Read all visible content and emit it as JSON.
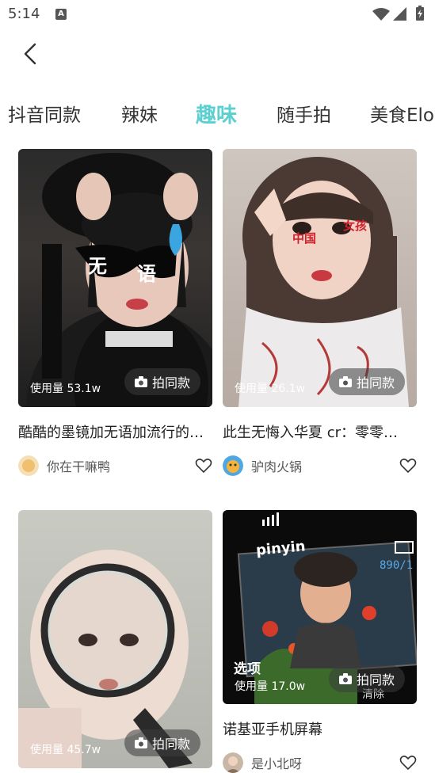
{
  "status_bar": {
    "time": "5:14",
    "indicator": "A"
  },
  "tabs": [
    {
      "label": "抖音同款"
    },
    {
      "label": "辣妹"
    },
    {
      "label": "趣味"
    },
    {
      "label": "随手拍"
    },
    {
      "label": "美食Elo"
    }
  ],
  "cards": [
    {
      "usage": "使用量 53.1w",
      "button": "拍同款",
      "title": "酷酷的墨镜加无语加流行的…",
      "author": "你在干嘛鸭",
      "overlay": [
        "无",
        "语"
      ]
    },
    {
      "usage": "使用量 26.1w",
      "button": "拍同款",
      "title": "此生无悔入华夏  cr：零零…",
      "author": "驴肉火锅",
      "overlay": [
        "中国",
        "女孩"
      ]
    },
    {
      "usage": "使用量 45.7w",
      "button": "拍同款",
      "title": "",
      "author": ""
    },
    {
      "usage": "使用量 17.0w",
      "button": "拍同款",
      "title": "诺基亚手机屏幕",
      "author": "是小北呀",
      "overlay": [
        "pinyin",
        "890/1",
        "选项",
        "清除"
      ]
    }
  ],
  "colors": {
    "accent": "#5ccfd0"
  }
}
